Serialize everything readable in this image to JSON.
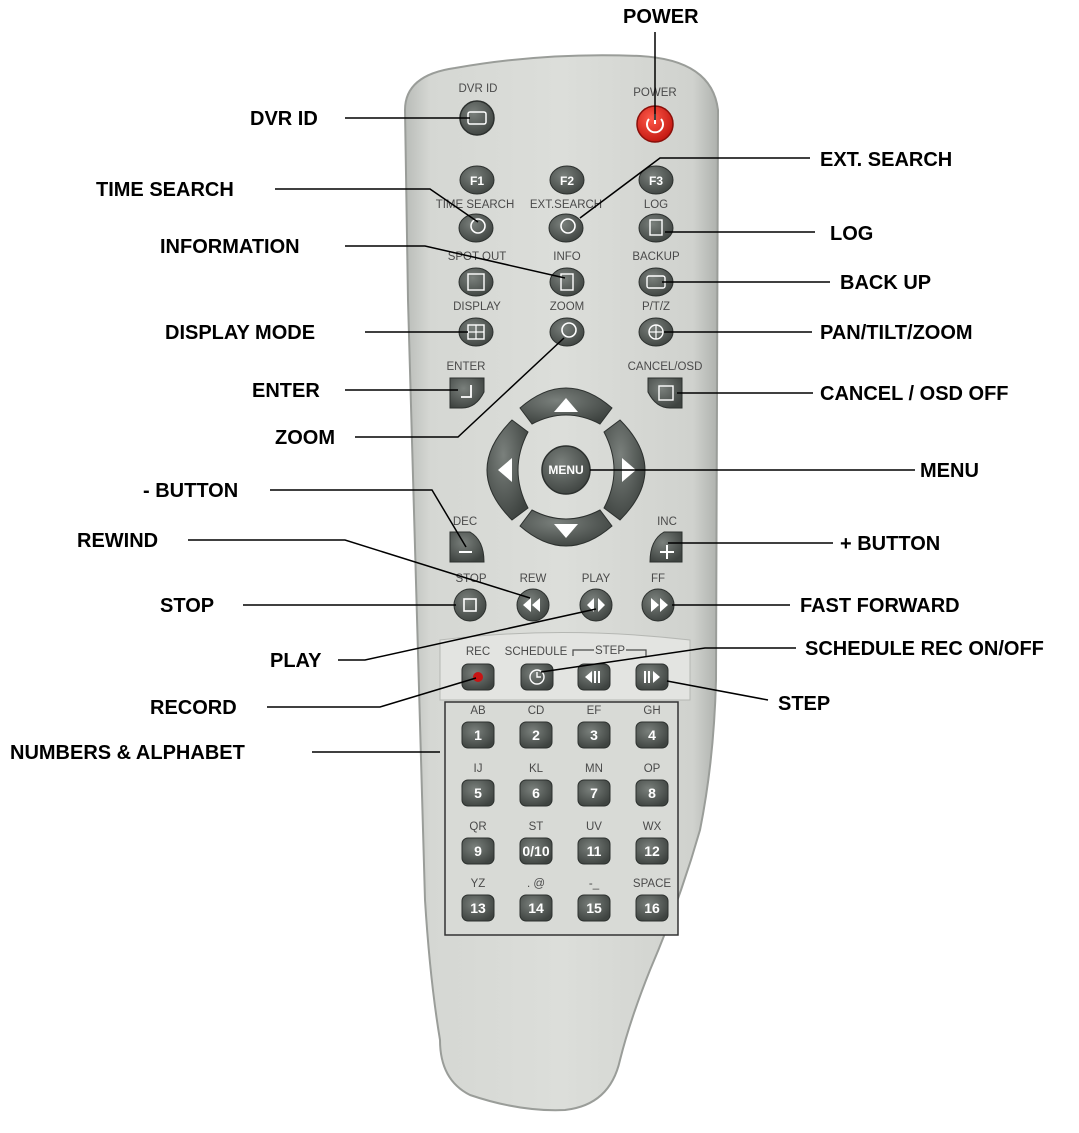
{
  "callouts": {
    "power": "POWER",
    "dvr_id": "DVR ID",
    "ext_search": "EXT. SEARCH",
    "time_search": "TIME SEARCH",
    "log": "LOG",
    "information": "INFORMATION",
    "back_up": "BACK UP",
    "display_mode": "DISPLAY MODE",
    "pan_tilt_zoom": "PAN/TILT/ZOOM",
    "enter": "ENTER",
    "cancel_osd_off": "CANCEL / OSD OFF",
    "zoom": "ZOOM",
    "menu": "MENU",
    "minus_button": "- BUTTON",
    "rewind": "REWIND",
    "plus_button": "+ BUTTON",
    "stop": "STOP",
    "fast_forward": "FAST FORWARD",
    "play": "PLAY",
    "schedule_rec": "SCHEDULE REC ON/OFF",
    "record": "RECORD",
    "step": "STEP",
    "numbers_alphabet": "NUMBERS & ALPHABET"
  },
  "remote_labels": {
    "dvr_id": "DVR ID",
    "power": "POWER",
    "f1": "F1",
    "f2": "F2",
    "f3": "F3",
    "time_search": "TIME SEARCH",
    "ext_search": "EXT.SEARCH",
    "log": "LOG",
    "spot_out": "SPOT OUT",
    "info": "INFO",
    "backup": "BACKUP",
    "display": "DISPLAY",
    "zoom": "ZOOM",
    "ptz": "P/T/Z",
    "enter": "ENTER",
    "cancel_osd": "CANCEL/OSD",
    "menu": "MENU",
    "dec": "DEC",
    "inc": "INC",
    "stop": "STOP",
    "rew": "REW",
    "play": "PLAY",
    "ff": "FF",
    "rec": "REC",
    "schedule": "SCHEDULE",
    "step": "STEP"
  },
  "keypad": [
    {
      "letters": "AB",
      "number": "1"
    },
    {
      "letters": "CD",
      "number": "2"
    },
    {
      "letters": "EF",
      "number": "3"
    },
    {
      "letters": "GH",
      "number": "4"
    },
    {
      "letters": "IJ",
      "number": "5"
    },
    {
      "letters": "KL",
      "number": "6"
    },
    {
      "letters": "MN",
      "number": "7"
    },
    {
      "letters": "OP",
      "number": "8"
    },
    {
      "letters": "QR",
      "number": "9"
    },
    {
      "letters": "ST",
      "number": "0/10"
    },
    {
      "letters": "UV",
      "number": "11"
    },
    {
      "letters": "WX",
      "number": "12"
    },
    {
      "letters": "YZ",
      "number": "13"
    },
    {
      "letters": ". @",
      "number": "14"
    },
    {
      "letters": "-_",
      "number": "15"
    },
    {
      "letters": "SPACE",
      "number": "16"
    }
  ],
  "colors": {
    "body": "#d4d6d2",
    "button": "#555b57",
    "power": "#e0251f",
    "record_dot": "#c81414"
  }
}
